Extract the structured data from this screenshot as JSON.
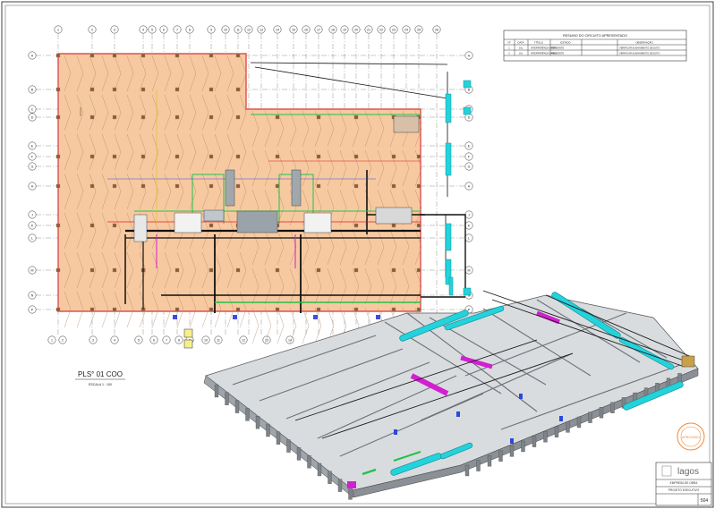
{
  "sheet": {
    "view_title": "PLS° 01 COO",
    "view_subtitle": "ESCALA 1 : 100"
  },
  "revision_table": {
    "title": "RESUMO DO CIRCUITO APRESENTADO",
    "headers": [
      "Nº",
      "DATA",
      "TÍTULO",
      "ESTADO",
      "OBSERVAÇÃO"
    ],
    "rows": [
      [
        "1",
        "JUL",
        "INTERFERÊNCIA ESTR.",
        "PENDENTE",
        "VERIFICAR ALINHAMENTO DE DUTO"
      ],
      [
        "2",
        "JUL",
        "INTERFERÊNCIA HVAC",
        "PENDENTE",
        "VERIFICAR ALINHAMENTO DE DUTO"
      ]
    ]
  },
  "grid_bubbles": {
    "top": [
      "1",
      "2",
      "3",
      "4",
      "5",
      "6",
      "7",
      "8",
      "9",
      "10",
      "11",
      "12",
      "13",
      "14",
      "15",
      "16",
      "17",
      "18",
      "19",
      "20",
      "21",
      "22",
      "23",
      "24",
      "25",
      "26"
    ],
    "left": [
      "A",
      "B",
      "C",
      "D",
      "E",
      "F",
      "G",
      "H",
      "J",
      "K",
      "L",
      "M",
      "N",
      "P"
    ],
    "bottom": [
      "1",
      "2",
      "3",
      "4",
      "5",
      "6",
      "7",
      "8",
      "9",
      "10",
      "11",
      "12",
      "13",
      "14"
    ]
  },
  "title_block": {
    "logo_text": "lagos",
    "row1": "EMPRESA DE OBRA",
    "row2": "PROJETO EXECUTIVO",
    "sheet_number": "504"
  },
  "stamp": {
    "text": "APROVADO"
  },
  "colors": {
    "slab": "#f7c9a0",
    "slab_edge": "#e05050",
    "duct": "#22d3dc",
    "pipe": "#111111",
    "accent_green": "#21c24a",
    "accent_magenta": "#d21fd2",
    "model_grey": "#9aa0a6"
  }
}
